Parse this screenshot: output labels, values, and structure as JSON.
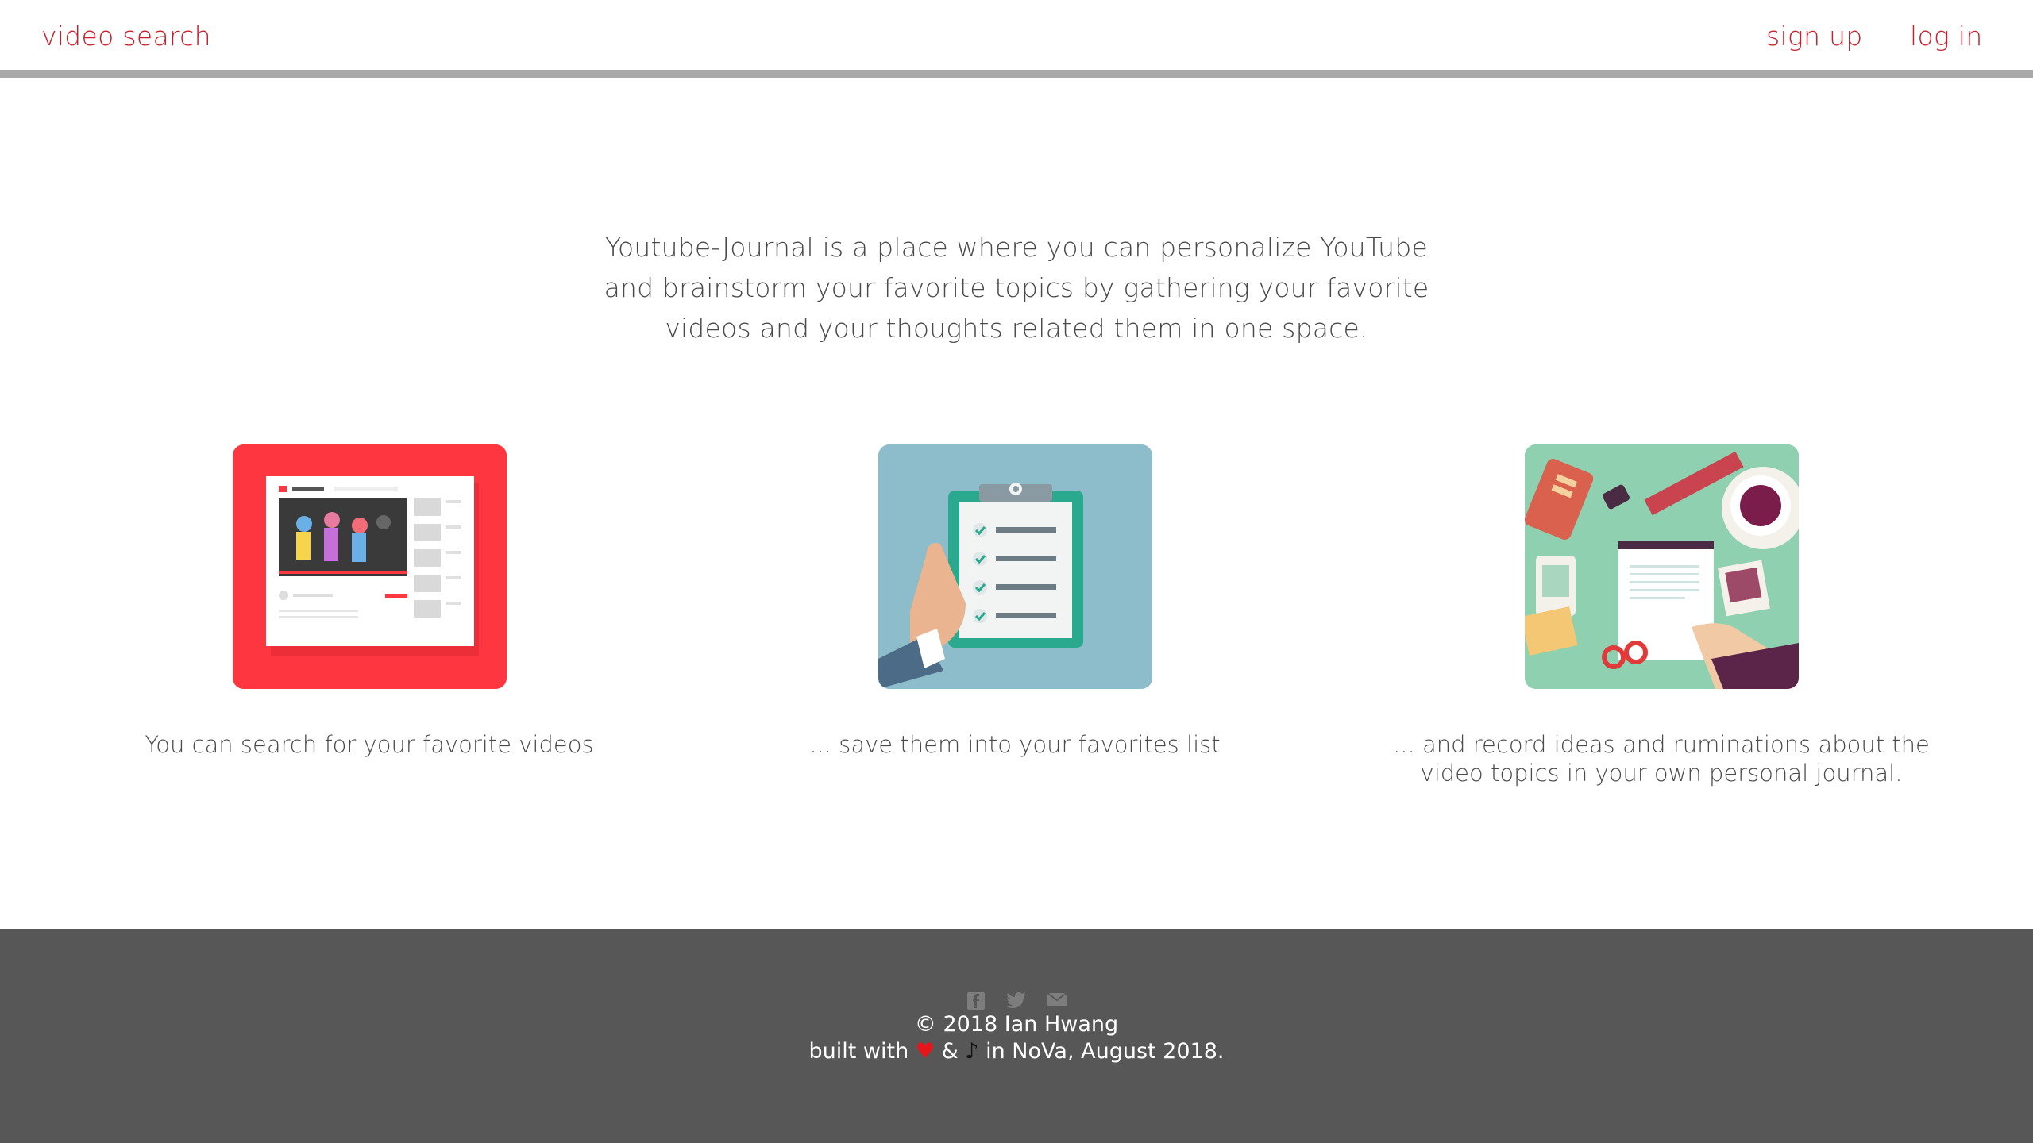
{
  "nav": {
    "brand": "video search",
    "signup": "sign up",
    "login": "log in"
  },
  "intro": {
    "text": "Youtube-Journal is a place where you can personalize YouTube and brainstorm your favorite topics by gathering your favorite videos and your thoughts related them in one space."
  },
  "features": [
    {
      "caption": "You can search for your favorite videos",
      "icon": "video-player-illustration",
      "bg": "#fe363f"
    },
    {
      "caption": "... save them into your favorites list",
      "icon": "clipboard-checklist-illustration",
      "bg": "#8dbccb"
    },
    {
      "caption": "... and record ideas and ruminations about the video topics in your own personal journal.",
      "icon": "journal-desk-illustration",
      "bg": "#8fd0b1"
    }
  ],
  "footer": {
    "social_icons": [
      "facebook-icon",
      "twitter-icon",
      "email-icon"
    ],
    "copyright": "© 2018 Ian Hwang",
    "built_prefix": "built with",
    "built_and": "&",
    "built_suffix": "in NoVa, August 2018.",
    "heart_glyph": "♥",
    "note_glyph": "♪"
  },
  "colors": {
    "accent": "#c8202c",
    "footer_bg": "#575757",
    "text": "#4a4a4a"
  }
}
